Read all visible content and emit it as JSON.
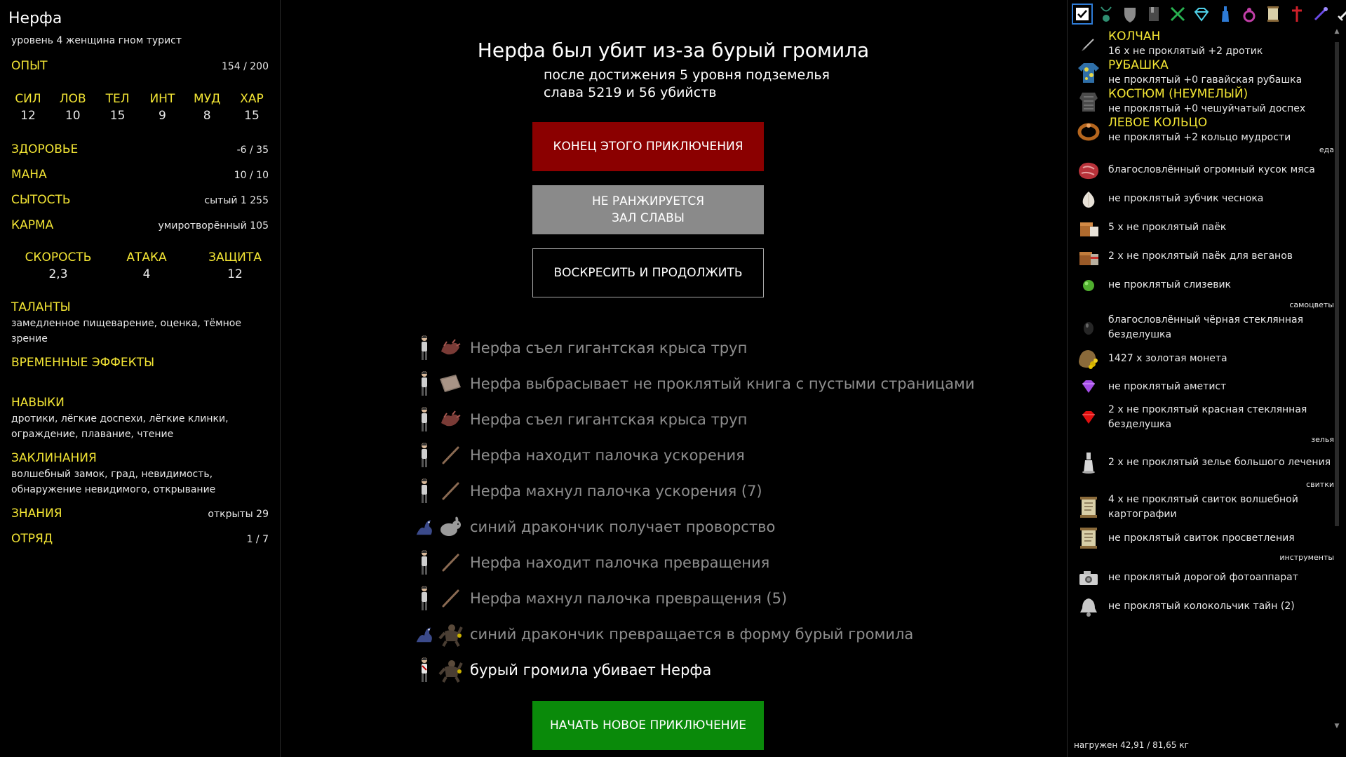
{
  "character": {
    "name": "Нерфа",
    "subtitle": "уровень 4 женщина гном турист",
    "exp_label": "ОПЫТ",
    "exp_value": "154 / 200",
    "stats": [
      {
        "label": "СИЛ",
        "value": "12"
      },
      {
        "label": "ЛОВ",
        "value": "10"
      },
      {
        "label": "ТЕЛ",
        "value": "15"
      },
      {
        "label": "ИНТ",
        "value": "9"
      },
      {
        "label": "МУД",
        "value": "8"
      },
      {
        "label": "ХАР",
        "value": "15"
      }
    ],
    "health_label": "ЗДОРОВЬЕ",
    "health_value": "-6 / 35",
    "mana_label": "МАНА",
    "mana_value": "10 / 10",
    "satiety_label": "СЫТОСТЬ",
    "satiety_value": "сытый 1 255",
    "karma_label": "КАРМА",
    "karma_value": "умиротворённый 105",
    "combat": [
      {
        "label": "СКОРОСТЬ",
        "value": "2,3"
      },
      {
        "label": "АТАКА",
        "value": "4"
      },
      {
        "label": "ЗАЩИТА",
        "value": "12"
      }
    ],
    "talents_label": "ТАЛАНТЫ",
    "talents_text": "замедленное пищеварение, оценка, тёмное зрение",
    "effects_label": "ВРЕМЕННЫЕ ЭФФЕКТЫ",
    "skills_label": "НАВЫКИ",
    "skills_text": "дротики, лёгкие доспехи, лёгкие клинки, ограждение, плавание, чтение",
    "spells_label": "ЗАКЛИНАНИЯ",
    "spells_text": "волшебный замок, град, невидимость, обнаружение невидимого, открывание",
    "knowledge_label": "ЗНАНИЯ",
    "knowledge_value": "открыты 29",
    "party_label": "ОТРЯД",
    "party_value": "1 / 7"
  },
  "death": {
    "title": "Нерфа был убит из-за бурый громила",
    "line1": "после достижения 5 уровня подземелья",
    "line2": "слава 5219 и 56 убийств",
    "btn_end": "КОНЕЦ ЭТОГО ПРИКЛЮЧЕНИЯ",
    "btn_rank_1": "НЕ РАНЖИРУЕТСЯ",
    "btn_rank_2": "ЗАЛ СЛАВЫ",
    "btn_revive": "ВОСКРЕСИТЬ И ПРОДОЛЖИТЬ",
    "btn_new": "НАЧАТЬ НОВОЕ ПРИКЛЮЧЕНИЕ"
  },
  "log": [
    {
      "text": "Нерфа съел гигантская крыса труп",
      "actor": "hero-icon",
      "object": "rat-corpse-icon"
    },
    {
      "text": "Нерфа выбрасывает не проклятый книга с пустыми страницами",
      "actor": "hero-icon",
      "object": "book-icon"
    },
    {
      "text": "Нерфа съел гигантская крыса труп",
      "actor": "hero-icon",
      "object": "rat-corpse-icon"
    },
    {
      "text": "Нерфа находит палочка ускорения",
      "actor": "hero-icon",
      "object": "wand-icon"
    },
    {
      "text": "Нерфа махнул палочка ускорения (7)",
      "actor": "hero-icon",
      "object": "wand-icon"
    },
    {
      "text": "синий дракончик получает проворство",
      "actor": "dragon-icon",
      "object": "rabbit-icon"
    },
    {
      "text": "Нерфа находит палочка превращения",
      "actor": "hero-icon",
      "object": "wand-icon"
    },
    {
      "text": "Нерфа махнул палочка превращения (5)",
      "actor": "hero-icon",
      "object": "wand-icon"
    },
    {
      "text": "синий дракончик превращается в форму бурый громила",
      "actor": "dragon-icon",
      "object": "brute-icon"
    },
    {
      "text": "бурый громила убивает Нерфа",
      "actor": "hero-dead-icon",
      "object": "brute-icon"
    }
  ],
  "inventory": {
    "equipped": [
      {
        "slot": "КОЛЧАН",
        "desc": "16 x не проклятый +2 дротик",
        "icon": "dart-icon"
      },
      {
        "slot": "РУБАШКА",
        "desc": "не проклятый +0 гавайская рубашка",
        "icon": "shirt-icon"
      },
      {
        "slot": "КОСТЮМ (НЕУМЕЛЫЙ)",
        "desc": "не проклятый +0 чешуйчатый доспех",
        "icon": "armor-icon"
      },
      {
        "slot": "ЛЕВОЕ КОЛЬЦО",
        "desc": "не проклятый +2 кольцо мудрости",
        "icon": "ring-icon"
      }
    ],
    "cat_food": "еда",
    "food": [
      {
        "desc": "благословлённый огромный кусок мяса",
        "icon": "meat-icon"
      },
      {
        "desc": "не проклятый зубчик чеснока",
        "icon": "garlic-icon"
      },
      {
        "desc": "5 x не проклятый паёк",
        "icon": "ration-icon"
      },
      {
        "desc": "2 x не проклятый паёк для веганов",
        "icon": "vegan-ration-icon"
      },
      {
        "desc": "не проклятый слизевик",
        "icon": "slime-mold-icon"
      }
    ],
    "cat_gems": "самоцветы",
    "gems": [
      {
        "desc": "благословлённый чёрная стеклянная безделушка",
        "icon": "black-gem-icon"
      },
      {
        "desc": "1427 x золотая монета",
        "icon": "gold-icon"
      },
      {
        "desc": "не проклятый аметист",
        "icon": "amethyst-icon"
      },
      {
        "desc": "2 x не проклятый красная стеклянная безделушка",
        "icon": "red-gem-icon"
      }
    ],
    "cat_potions": "зелья",
    "potions": [
      {
        "desc": "2 x не проклятый зелье большого лечения",
        "icon": "potion-icon"
      }
    ],
    "cat_scrolls": "свитки",
    "scrolls": [
      {
        "desc": "4 x не проклятый свиток волшебной картографии",
        "icon": "scroll-icon"
      },
      {
        "desc": "не проклятый свиток просветления",
        "icon": "scroll-icon"
      }
    ],
    "cat_tools": "инструменты",
    "tools": [
      {
        "desc": "не проклятый дорогой фотоаппарат",
        "icon": "camera-icon"
      },
      {
        "desc": "не проклятый колокольчик тайн (2)",
        "icon": "bell-icon"
      }
    ],
    "weight": "нагружен 42,91 / 81,65 кг"
  },
  "tabs": [
    "checkmark-icon",
    "amulet-icon",
    "shield-icon",
    "book-tab-icon",
    "crossed-swords-icon",
    "gem-tab-icon",
    "potion-tab-icon",
    "ring-tab-icon",
    "scroll-tab-icon",
    "cross-icon",
    "wand-tab-icon",
    "sword-tab-icon"
  ],
  "colors": {
    "accent": "#f3e534",
    "end_button": "#8b0000",
    "rank_button": "#8a8a8a",
    "new_button": "#0a8a0a",
    "log_text": "#8e8e8e"
  }
}
